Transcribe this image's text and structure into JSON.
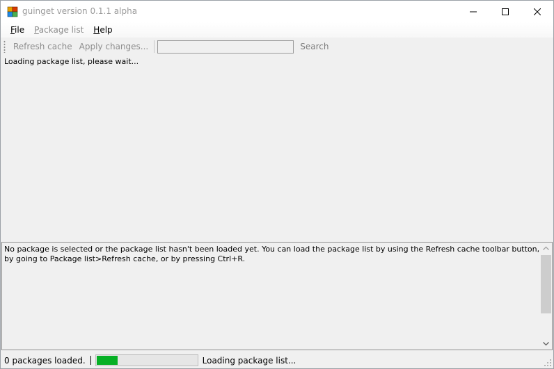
{
  "window": {
    "title": "guinget version 0.1.1 alpha"
  },
  "menu": {
    "file": {
      "accel": "F",
      "rest": "ile"
    },
    "package_list": {
      "accel": "P",
      "rest": "ackage list"
    },
    "help": {
      "accel": "H",
      "rest": "elp"
    }
  },
  "toolbar": {
    "refresh_cache": "Refresh cache",
    "apply_changes": "Apply changes...",
    "search_value": "",
    "search_label": "Search"
  },
  "package_list": {
    "loading_text": "Loading package list, please wait..."
  },
  "details": {
    "text": "No package is selected or the package list hasn't been loaded yet. You can load the package list by using the Refresh cache toolbar button, by going to Package list>Refresh cache, or by pressing Ctrl+R."
  },
  "status": {
    "packages_loaded": "0 packages loaded.",
    "progress_fraction": 0.21,
    "message": "Loading package list..."
  },
  "colors": {
    "progress_fill": "#06b025",
    "disabled_text": "#8d8d8d",
    "window_bg": "#f0f0f0"
  },
  "icons": [
    "app-icon",
    "minimize-icon",
    "maximize-icon",
    "close-icon",
    "toolstrip-grip-icon",
    "scroll-up-icon",
    "scroll-down-icon",
    "size-grip-icon"
  ]
}
